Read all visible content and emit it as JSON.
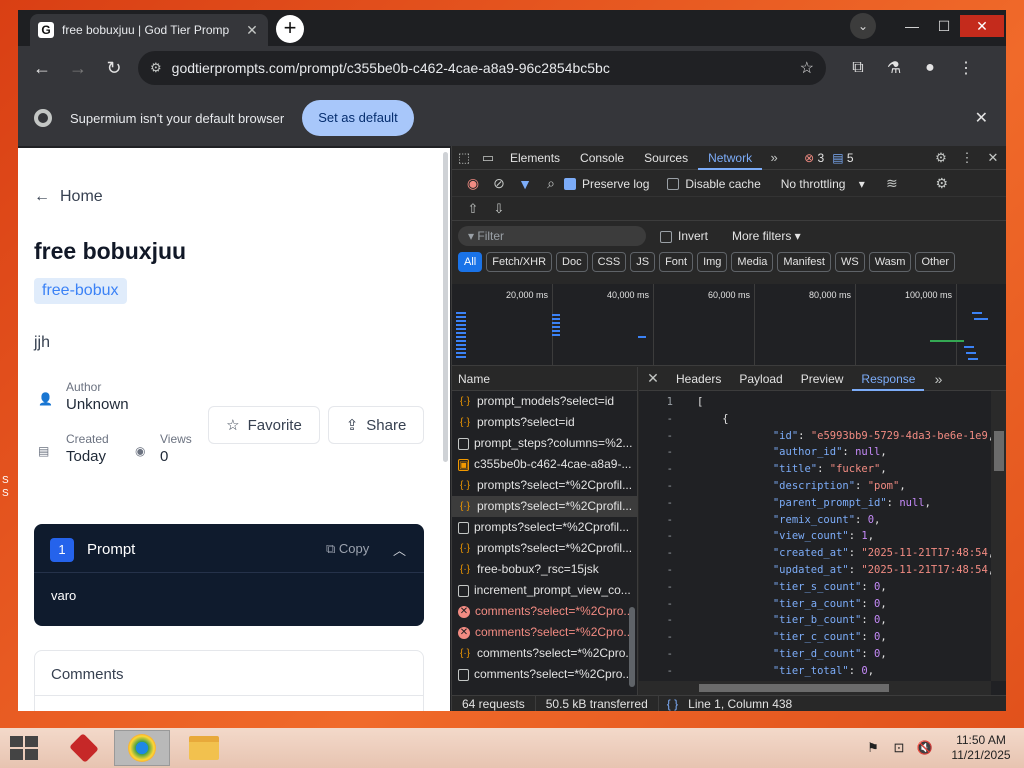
{
  "browser": {
    "tab_title": "free bobuxjuu | God Tier Promp",
    "tab_favicon_letter": "G",
    "url": "godtierprompts.com/prompt/c355be0b-c462-4cae-a8a9-96c2854bc5bc",
    "infobar_text": "Supermium isn't your default browser",
    "infobar_button": "Set as default"
  },
  "page": {
    "home_link": "Home",
    "title": "free bobuxjuu",
    "tag": "free-bobux",
    "description": "jjh",
    "author_label": "Author",
    "author_value": "Unknown",
    "created_label": "Created",
    "created_value": "Today",
    "views_label": "Views",
    "views_value": "0",
    "favorite_button": "Favorite",
    "share_button": "Share",
    "prompt_number": "1",
    "prompt_title": "Prompt",
    "copy_label": "Copy",
    "prompt_body": "varo",
    "comments_title": "Comments"
  },
  "devtools": {
    "tabs": [
      "Elements",
      "Console",
      "Sources",
      "Network"
    ],
    "active_tab": "Network",
    "error_count": "3",
    "message_count": "5",
    "preserve_log": "Preserve log",
    "disable_cache": "Disable cache",
    "throttling": "No throttling",
    "filter_placeholder": "Filter",
    "invert": "Invert",
    "more_filters": "More filters",
    "chips": [
      "All",
      "Fetch/XHR",
      "Doc",
      "CSS",
      "JS",
      "Font",
      "Img",
      "Media",
      "Manifest",
      "WS",
      "Wasm",
      "Other"
    ],
    "timeline_labels": [
      "20,000 ms",
      "40,000 ms",
      "60,000 ms",
      "80,000 ms",
      "100,000 ms"
    ],
    "name_header": "Name",
    "requests": [
      {
        "name": "prompt_models?select=id",
        "type": "fetch"
      },
      {
        "name": "prompts?select=id",
        "type": "fetch"
      },
      {
        "name": "prompt_steps?columns=%2...",
        "type": "doc"
      },
      {
        "name": "c355be0b-c462-4cae-a8a9-...",
        "type": "img"
      },
      {
        "name": "prompts?select=*%2Cprofil...",
        "type": "fetch"
      },
      {
        "name": "prompts?select=*%2Cprofil...",
        "type": "fetch"
      },
      {
        "name": "prompts?select=*%2Cprofil...",
        "type": "doc"
      },
      {
        "name": "prompts?select=*%2Cprofil...",
        "type": "fetch"
      },
      {
        "name": "free-bobux?_rsc=15jsk",
        "type": "fetch"
      },
      {
        "name": "increment_prompt_view_co...",
        "type": "doc"
      },
      {
        "name": "comments?select=*%2Cpro...",
        "type": "err"
      },
      {
        "name": "comments?select=*%2Cpro...",
        "type": "err"
      },
      {
        "name": "comments?select=*%2Cpro...",
        "type": "fetch"
      },
      {
        "name": "comments?select=*%2Cpro...",
        "type": "doc"
      }
    ],
    "response_tabs": [
      "Headers",
      "Payload",
      "Preview",
      "Response"
    ],
    "active_response_tab": "Response",
    "response_lines": [
      {
        "g": "1",
        "t": "["
      },
      {
        "g": "-",
        "t": "    {"
      },
      {
        "g": "-",
        "k": "\"id\"",
        "v": "\"e5993bb9-5729-4da3-be6e-1e9",
        "vt": "str"
      },
      {
        "g": "-",
        "k": "\"author_id\"",
        "v": "null",
        "vt": "nul"
      },
      {
        "g": "-",
        "k": "\"title\"",
        "v": "\"fucker\"",
        "vt": "str"
      },
      {
        "g": "-",
        "k": "\"description\"",
        "v": "\"pom\"",
        "vt": "str"
      },
      {
        "g": "-",
        "k": "\"parent_prompt_id\"",
        "v": "null",
        "vt": "nul"
      },
      {
        "g": "-",
        "k": "\"remix_count\"",
        "v": "0",
        "vt": "num"
      },
      {
        "g": "-",
        "k": "\"view_count\"",
        "v": "1",
        "vt": "num"
      },
      {
        "g": "-",
        "k": "\"created_at\"",
        "v": "\"2025-11-21T17:48:54",
        "vt": "str"
      },
      {
        "g": "-",
        "k": "\"updated_at\"",
        "v": "\"2025-11-21T17:48:54",
        "vt": "str"
      },
      {
        "g": "-",
        "k": "\"tier_s_count\"",
        "v": "0",
        "vt": "num"
      },
      {
        "g": "-",
        "k": "\"tier_a_count\"",
        "v": "0",
        "vt": "num"
      },
      {
        "g": "-",
        "k": "\"tier_b_count\"",
        "v": "0",
        "vt": "num"
      },
      {
        "g": "-",
        "k": "\"tier_c_count\"",
        "v": "0",
        "vt": "num"
      },
      {
        "g": "-",
        "k": "\"tier_d_count\"",
        "v": "0",
        "vt": "num"
      },
      {
        "g": "-",
        "k": "\"tier_total\"",
        "v": "0",
        "vt": "num"
      }
    ],
    "status_requests": "64 requests",
    "status_transferred": "50.5 kB transferred",
    "status_cursor": "Line 1, Column 438"
  },
  "taskbar": {
    "time": "11:50 AM",
    "date": "11/21/2025"
  },
  "desktop": {
    "icon_label": "S\nS"
  }
}
